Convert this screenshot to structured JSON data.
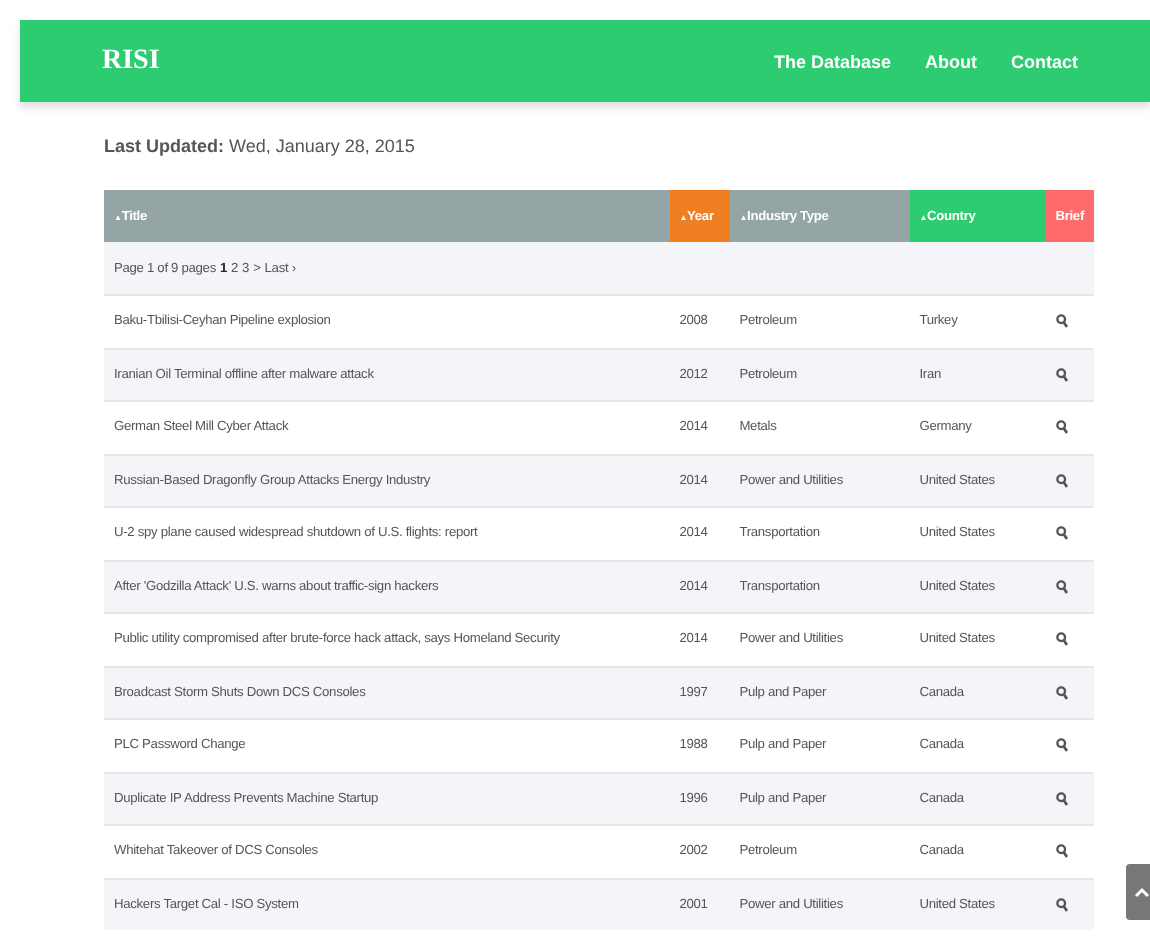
{
  "navbar": {
    "logo": "RISI",
    "links": [
      "The Database",
      "About",
      "Contact"
    ]
  },
  "last_updated": {
    "label": "Last Updated:",
    "value": "Wed, January 28, 2015"
  },
  "table": {
    "columns": [
      {
        "label": "Title",
        "sort_icon": "▲",
        "color": "#95a5a6"
      },
      {
        "label": "Year",
        "sort_icon": "▲",
        "color": "#f07f23"
      },
      {
        "label": "Industry Type",
        "sort_icon": "▲",
        "color": "#95a5a6"
      },
      {
        "label": "Country",
        "sort_icon": "▲",
        "color": "#2ecc71"
      },
      {
        "label": "Brief",
        "color": "#ff6b6b"
      }
    ],
    "pagination": {
      "summary": "Page 1 of 9 pages",
      "pages": [
        {
          "label": "1",
          "selected": true
        },
        {
          "label": "2",
          "selected": false
        },
        {
          "label": "3",
          "selected": false
        },
        {
          "label": ">",
          "selected": false
        },
        {
          "label": "Last ›",
          "selected": false
        }
      ]
    },
    "rows": [
      {
        "title": "Baku-Tbilisi-Ceyhan Pipeline explosion",
        "year": "2008",
        "industry": "Petroleum",
        "country": "Turkey"
      },
      {
        "title": "Iranian Oil Terminal offline after malware attack",
        "year": "2012",
        "industry": "Petroleum",
        "country": "Iran"
      },
      {
        "title": "German Steel Mill Cyber Attack",
        "year": "2014",
        "industry": "Metals",
        "country": "Germany"
      },
      {
        "title": "Russian-Based Dragonfly Group Attacks Energy Industry",
        "year": "2014",
        "industry": "Power and Utilities",
        "country": "United States"
      },
      {
        "title": "U-2 spy plane caused widespread shutdown of U.S. flights: report",
        "year": "2014",
        "industry": "Transportation",
        "country": "United States"
      },
      {
        "title": "After 'Godzilla Attack' U.S. warns about traffic-sign hackers",
        "year": "2014",
        "industry": "Transportation",
        "country": "United States"
      },
      {
        "title": "Public utility compromised after brute-force hack attack, says Homeland Security",
        "year": "2014",
        "industry": "Power and Utilities",
        "country": "United States"
      },
      {
        "title": "Broadcast Storm Shuts Down DCS Consoles",
        "year": "1997",
        "industry": "Pulp and Paper",
        "country": "Canada"
      },
      {
        "title": "PLC Password Change",
        "year": "1988",
        "industry": "Pulp and Paper",
        "country": "Canada"
      },
      {
        "title": "Duplicate IP Address Prevents Machine Startup",
        "year": "1996",
        "industry": "Pulp and Paper",
        "country": "Canada"
      },
      {
        "title": "Whitehat Takeover of DCS Consoles",
        "year": "2002",
        "industry": "Petroleum",
        "country": "Canada"
      },
      {
        "title": "Hackers Target Cal - ISO System",
        "year": "2001",
        "industry": "Power and Utilities",
        "country": "United States"
      }
    ]
  }
}
